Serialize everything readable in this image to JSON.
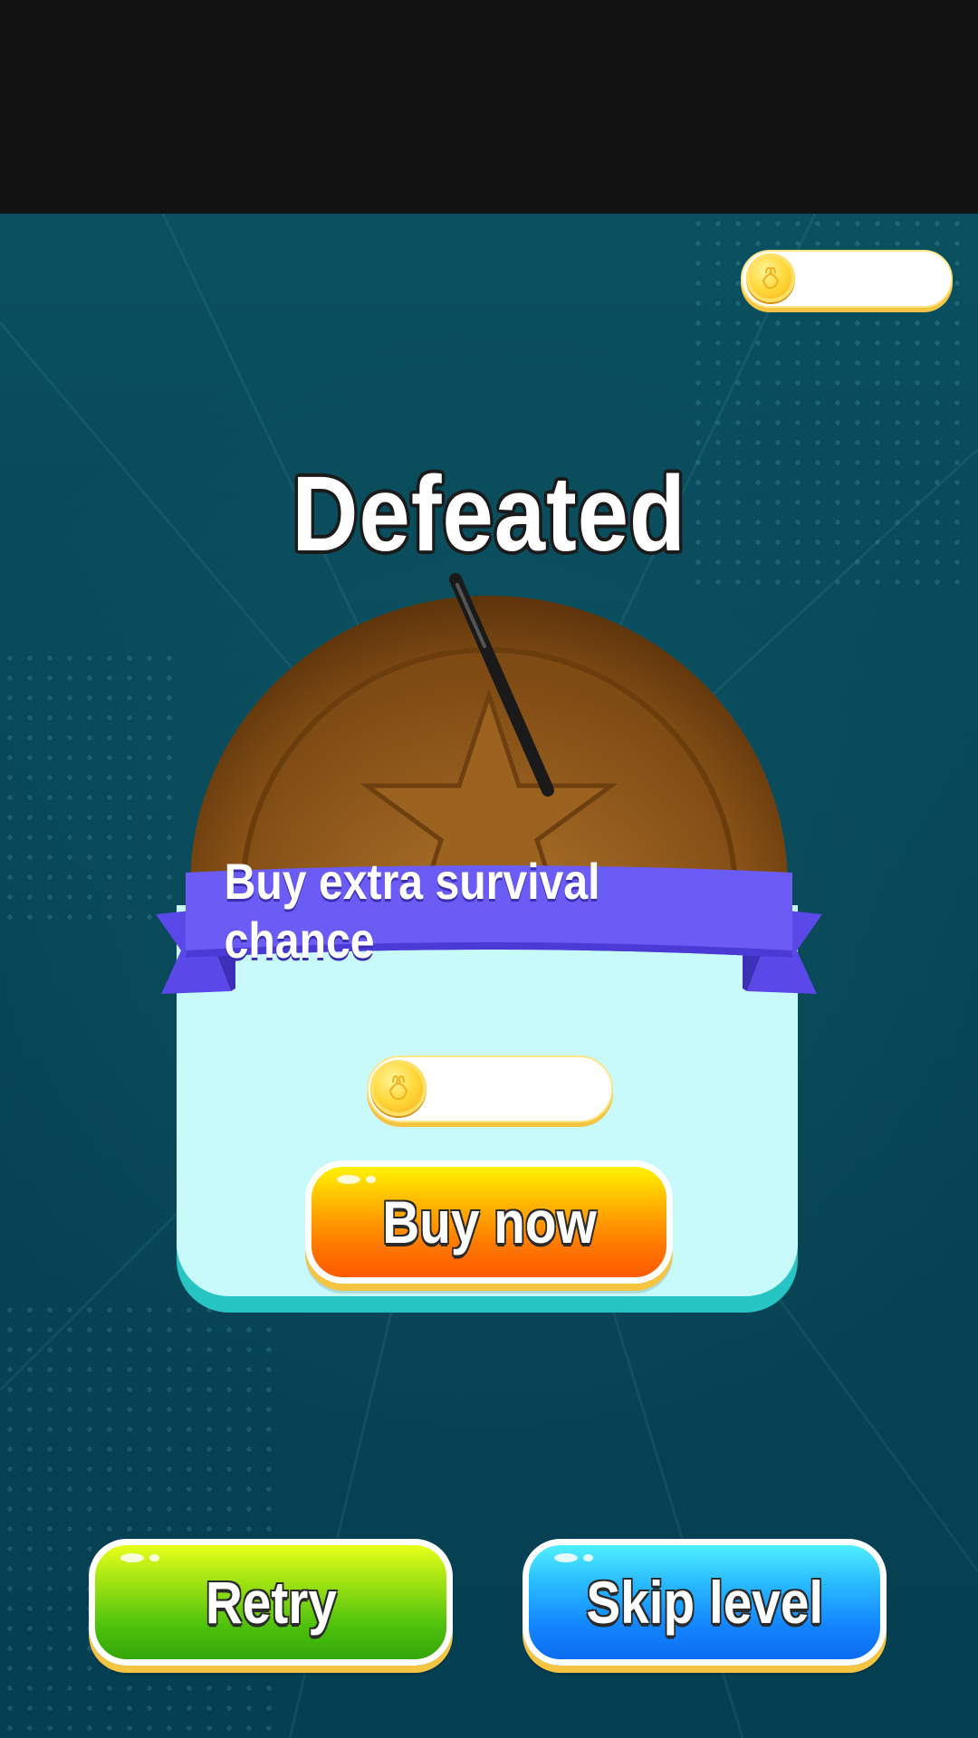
{
  "header": {
    "coin_balance": ""
  },
  "result": {
    "title": "Defeated"
  },
  "offer": {
    "ribbon_text": "Buy extra survival chance",
    "price": "",
    "buy_label": "Buy now"
  },
  "actions": {
    "retry_label": "Retry",
    "skip_label": "Skip level"
  },
  "icons": {
    "coin": "coin-icon",
    "cookie": "star-cookie-icon",
    "needle": "needle-icon"
  },
  "colors": {
    "background": "#064556",
    "card": "#c8fafb",
    "ribbon": "#6b5cf5",
    "buy": "#ff8a00",
    "retry": "#4fc20c",
    "skip": "#1486ff"
  }
}
